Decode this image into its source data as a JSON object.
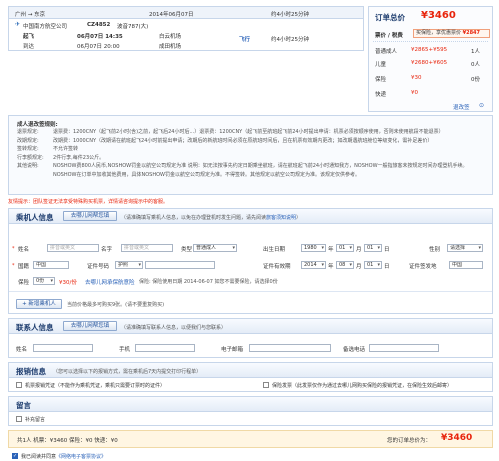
{
  "flight": {
    "route": "广州 → 东京",
    "date": "2014年06月07日",
    "total_duration": "约4小时25分钟",
    "airline": "中国南方航空公司",
    "flight_no": "CZ4852",
    "aircraft": "波音787(大)",
    "depart_label": "起飞",
    "depart_time": "06月07日 14:35",
    "depart_airport": "白云机场",
    "arrive_label": "到达",
    "arrive_time": "06月07日 20:00",
    "arrive_airport": "成田机场",
    "fly_tag": "飞行",
    "duration": "约4小时25分钟"
  },
  "order": {
    "title": "订单总价",
    "total": "¥3460",
    "type_label": "票价 / 税费",
    "type_value": "买保险，享优惠票价",
    "type_badge": "¥2847",
    "rows": [
      {
        "label": "普通成人",
        "price": "¥2865+¥595",
        "qty": "1人"
      },
      {
        "label": "儿童",
        "price": "¥2680+¥605",
        "qty": "0人"
      },
      {
        "label": "保险",
        "price": "¥30",
        "qty": "0份"
      },
      {
        "label": "快递",
        "price": "¥0",
        "qty": ""
      }
    ],
    "details_link": "退改签"
  },
  "rules": {
    "title": "成人退改签规则:",
    "items": [
      {
        "label": "退票规定:",
        "text": "退票费：1200CNY（起飞前2小时(含)之前，起飞后24小时后...）退票费：1200CNY（起飞前至航班起飞前24小时提出申请：机票必须按顺序使用，否则未使用航段不能退票）"
      },
      {
        "label": "改期规定:",
        "text": "改期费：1000CNY（改期请在航班起飞24小时前提出申请；改期后的新航班时间必须在原航班时间后，且在机票有效期内更改；如改期遇航班舱位等级变化，需补足差价）"
      },
      {
        "label": "签转规定:",
        "text": "不允许签转"
      },
      {
        "label": "行李额规定:",
        "text": "2件行李,每件23公斤。"
      },
      {
        "label": "其他说明:",
        "text": "NOSHOW费800人民币,NOSHOW罚金以航空公司规定为准 说明：如无法按事先约定日期乘坐航班，请在航班起飞前24小时通知我方，NOSHOW一般指旅客未按规定时间办理登机手续。"
      },
      {
        "label": "",
        "text": "NOSHOW在订单中加收其他费用，具体NOSHOW罚金以航空公司规定为准。不得签转。其他规定以航空公司规定为准。该规定仅供参考。"
      }
    ]
  },
  "notice": "友情提示：团队签证无法享受特殊购买机票，详情请咨询提示中的客服。",
  "passenger": {
    "title": "乘机人信息",
    "btn": "去哪儿网帮您填",
    "hint": "（请准确填写乘机人信息，以免在办理登机时发生问题，请先阅读",
    "hint_link": "旅客须知说明",
    "hint_end": "）",
    "last_label": "姓名",
    "last_ph": "拼音或英文",
    "first_label": "名字",
    "first_ph": "拼音或英文",
    "type_label": "类型",
    "type_value": "普通成人",
    "dob_label": "出生日期",
    "dob_y": "1980",
    "dob_m": "01",
    "dob_d": "01",
    "unit_y": "年",
    "unit_m": "月",
    "unit_d": "日",
    "gender_label": "性别",
    "gender_value": "请选择",
    "nat_label": "国籍",
    "nat_value": "中国",
    "idtype_label": "证件号码",
    "idtype_value": "护照",
    "idexp_label": "证件有效期",
    "exp_y": "2014",
    "exp_m": "08",
    "exp_d": "01",
    "issue_label": "证件签发地",
    "issue_value": "中国",
    "ins_label": "保险",
    "ins_value": "0份",
    "ins_note": "¥30/份",
    "ins_link": "去哪儿网承保航意险",
    "ins_after": "保险: 保险使用日期 2014-06-07  如您不需要保险，请选择0份",
    "add_btn": "+ 新增乘机人",
    "add_note": "当前价格最多可购买9张。(请不要重复购买)"
  },
  "contact": {
    "title": "联系人信息",
    "btn": "去哪儿网帮您填",
    "hint": "（请准确填写联系人信息，以便我们与您联系）",
    "name_label": "姓名",
    "phone_label": "手机",
    "email_label": "电子邮箱",
    "tel_label": "备选电话"
  },
  "invoice": {
    "title": "报销信息",
    "hint": "（您可以选择以下的报销方式，需在乘机后7天内提交打印行程单）",
    "opt1": "机票报销凭证（不能作为乘机凭证，乘机只需要订票时的证件）",
    "opt2": "保险发票（此发票仅作为通过去哪儿网购买保险的报销凭证，在保险生效后邮寄）"
  },
  "remark": {
    "title": "留言",
    "opt": "补充留言"
  },
  "summary": {
    "text": "共1人   机票：¥3460   保险：¥0   快递：¥0",
    "total_label": "您的订单总价为：",
    "total": "¥3460"
  },
  "agree": {
    "text": "我已阅读并同意",
    "link": "《网络电子客票协议》"
  }
}
